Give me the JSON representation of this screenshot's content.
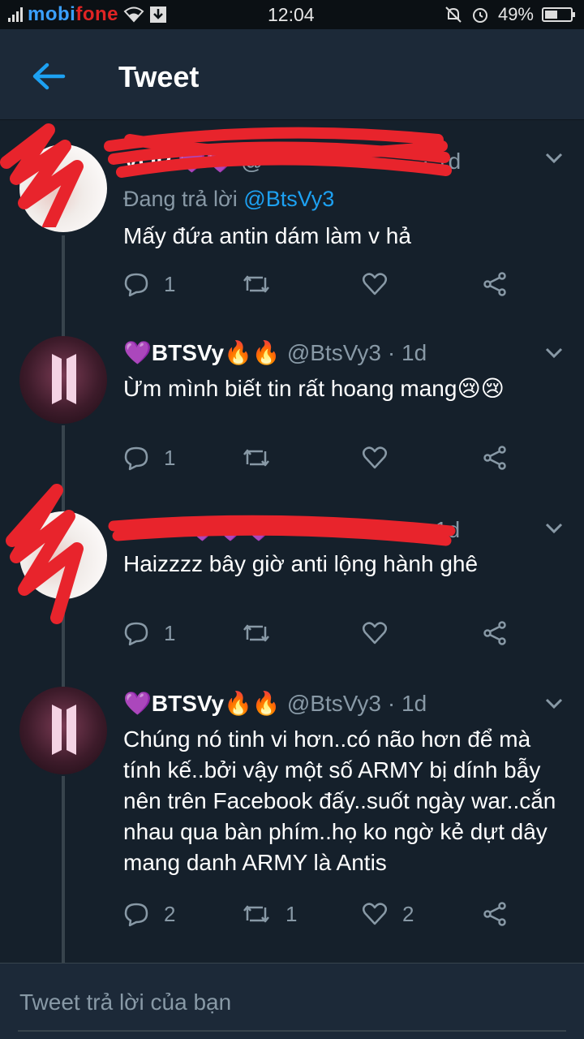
{
  "status_bar": {
    "carrier_a": "mobi",
    "carrier_b": "fone",
    "time": "12:04",
    "battery": "49%",
    "battery_level": 0.49
  },
  "header": {
    "title": "Tweet",
    "back_icon": "arrow-left-icon"
  },
  "tweets": [
    {
      "name": "VOP",
      "handle": "@",
      "time": "· 1d",
      "reply_label": "Đang trả lời",
      "reply_to": "@BtsVy3",
      "text": "Mấy đứa antin dám làm v hả",
      "replies": "1",
      "retweets": "",
      "likes": ""
    },
    {
      "name": "💜BTSVy🔥🔥",
      "handle": "@BtsVy3",
      "time": "· 1d",
      "text": "Ừm mình biết tin rất hoang mang😢😢",
      "replies": "1",
      "retweets": "",
      "likes": ""
    },
    {
      "name": "",
      "handle": "",
      "time": "1d",
      "text": "Haizzzz bây giờ anti lộng hành ghê",
      "replies": "1",
      "retweets": "",
      "likes": ""
    },
    {
      "name": "💜BTSVy🔥🔥",
      "handle": "@BtsVy3",
      "time": "· 1d",
      "text": "Chúng nó tinh vi hơn..có não hơn để mà tính kế..bởi vậy một số ARMY bị dính bẫy nên trên Facebook đấy..suốt  ngày war..cắn nhau qua bàn phím..họ ko ngờ kẻ dựt dây mang danh ARMY là Antis",
      "replies": "2",
      "retweets": "1",
      "likes": "2"
    }
  ],
  "reply_box": {
    "placeholder": "Tweet trả lời của bạn"
  },
  "colors": {
    "background": "#15202b",
    "header": "#1c2938",
    "accent": "#1da1f2",
    "muted": "#8899a6",
    "scribble": "#e8242c"
  }
}
